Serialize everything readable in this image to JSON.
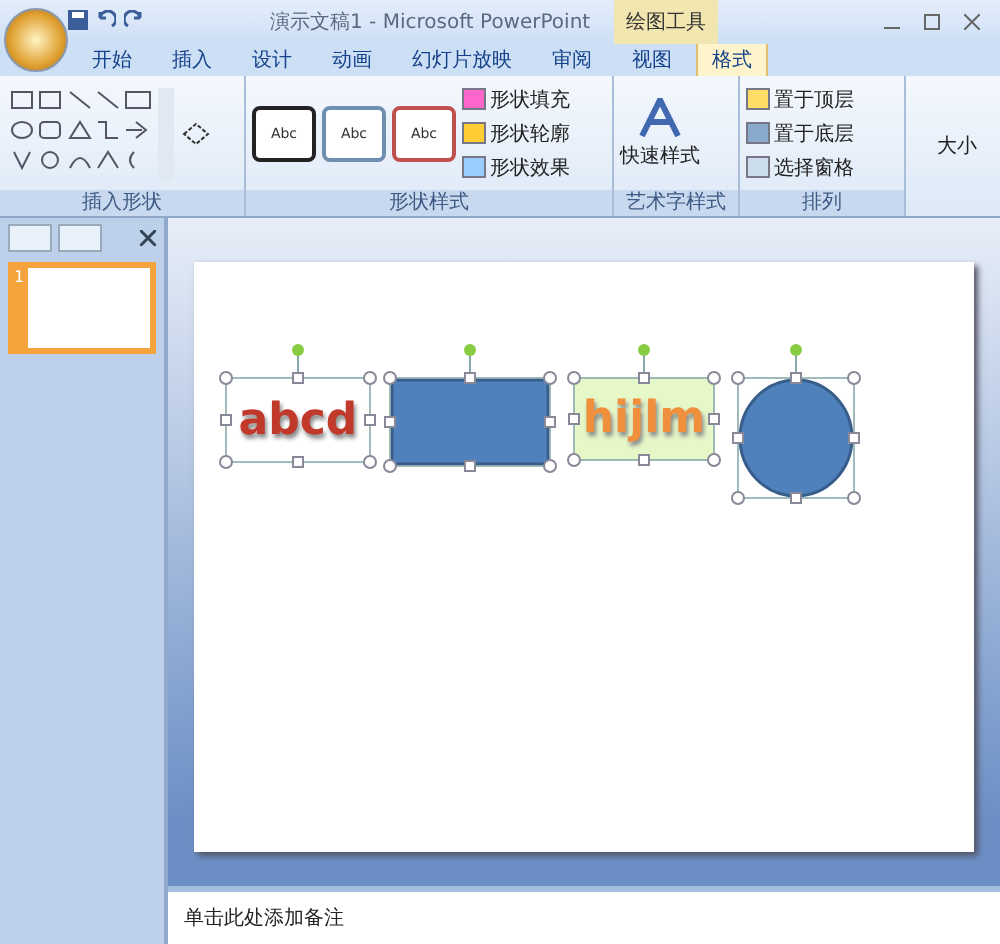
{
  "window": {
    "title": "演示文稿1 - Microsoft PowerPoint",
    "context_tab": "绘图工具"
  },
  "tabs": [
    {
      "label": "开始",
      "selected": false
    },
    {
      "label": "插入",
      "selected": false
    },
    {
      "label": "设计",
      "selected": false
    },
    {
      "label": "动画",
      "selected": false
    },
    {
      "label": "幻灯片放映",
      "selected": false
    },
    {
      "label": "审阅",
      "selected": false
    },
    {
      "label": "视图",
      "selected": false
    },
    {
      "label": "格式",
      "selected": true
    }
  ],
  "ribbon": {
    "insert_shapes": {
      "label": "插入形状"
    },
    "shape_styles": {
      "label": "形状样式",
      "styles": [
        {
          "label": "Abc",
          "color": "#222222"
        },
        {
          "label": "Abc",
          "color": "#6f8fb0"
        },
        {
          "label": "Abc",
          "color": "#c0504d"
        }
      ],
      "commands": [
        "形状填充",
        "形状轮廓",
        "形状效果"
      ]
    },
    "wordart_styles": {
      "label": "艺术字样式",
      "quick": "快速样式"
    },
    "arrange": {
      "label": "排列",
      "commands": [
        "置于顶层",
        "置于底层",
        "选择窗格"
      ]
    },
    "size": {
      "label": "大小"
    }
  },
  "slides_panel": {
    "slides": [
      {
        "number": "1",
        "selected": true
      }
    ]
  },
  "slide": {
    "shapes": [
      {
        "kind": "text",
        "text": "abcd",
        "color": "#c0392b",
        "filled": false,
        "selected": true
      },
      {
        "kind": "rect",
        "selected": true
      },
      {
        "kind": "text",
        "text": "hijlm",
        "color": "#f0903c",
        "filled": true,
        "selected": true
      },
      {
        "kind": "ellipse",
        "selected": true
      }
    ]
  },
  "notes": {
    "placeholder": "单击此处添加备注"
  }
}
